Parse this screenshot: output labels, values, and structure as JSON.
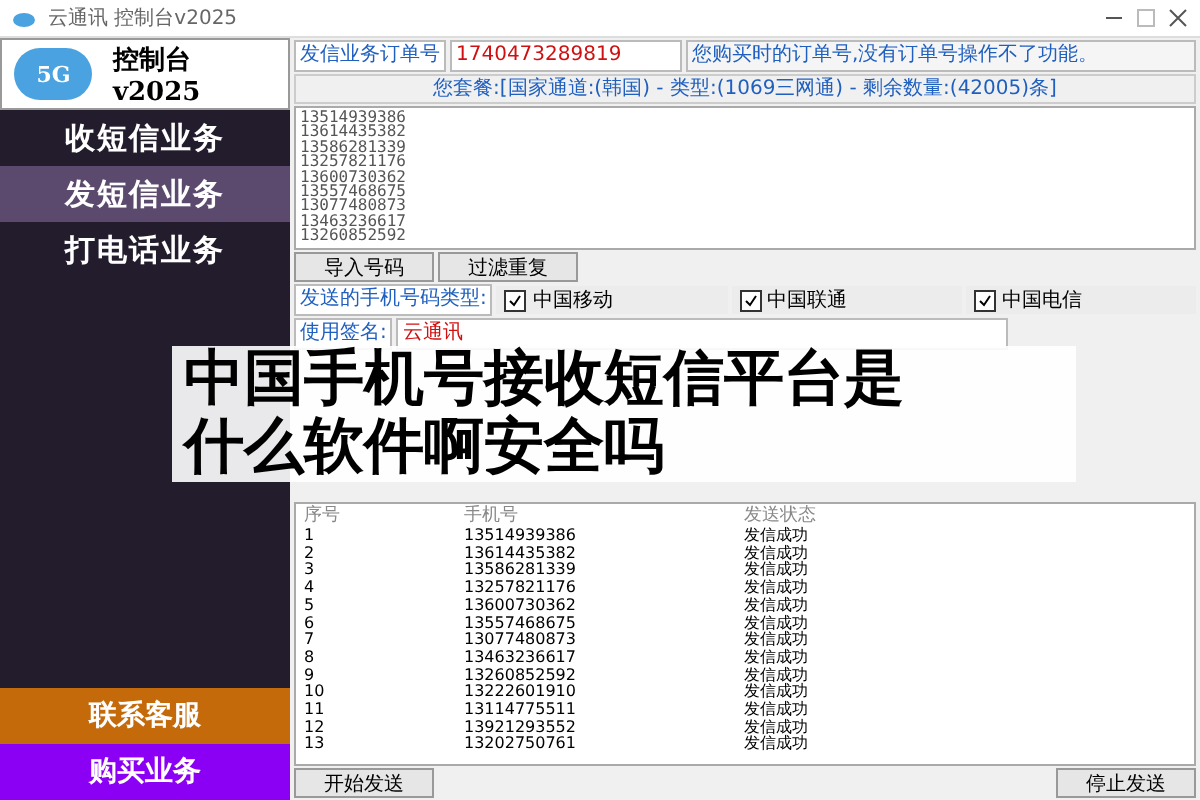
{
  "window": {
    "title": "云通讯 控制台v2025"
  },
  "logo": {
    "badge": "5G",
    "title": "控制台v2025"
  },
  "sidebar": {
    "items": [
      {
        "label": "收短信业务",
        "selected": false
      },
      {
        "label": "发短信业务",
        "selected": true
      },
      {
        "label": "打电话业务",
        "selected": false
      }
    ],
    "bottom_buttons": [
      {
        "label": "联系客服",
        "color": "#c46a0a"
      },
      {
        "label": "购买业务",
        "color": "#8b00f5"
      }
    ]
  },
  "order": {
    "label": "发信业务订单号",
    "value": "1740473289819",
    "hint": "您购买时的订单号,没有订单号操作不了功能。"
  },
  "package_info": "您套餐:[国家通道:(韩国) - 类型:(1069三网通) - 剩余数量:(42005)条]",
  "number_list": [
    "13514939386",
    "13614435382",
    "13586281339",
    "13257821176",
    "13600730362",
    "13557468675",
    "13077480873",
    "13463236617",
    "13260852592"
  ],
  "import_buttons": [
    "导入号码",
    "过滤重复"
  ],
  "carrier_label": "发送的手机号码类型:",
  "carriers": [
    {
      "label": "中国移动",
      "checked": true
    },
    {
      "label": "中国联通",
      "checked": true
    },
    {
      "label": "中国电信",
      "checked": true
    }
  ],
  "signature": {
    "label": "使用签名:",
    "value": "云通讯"
  },
  "table": {
    "columns": [
      "序号",
      "手机号",
      "发送状态"
    ],
    "rows": [
      [
        "1",
        "13514939386",
        "发信成功"
      ],
      [
        "2",
        "13614435382",
        "发信成功"
      ],
      [
        "3",
        "13586281339",
        "发信成功"
      ],
      [
        "4",
        "13257821176",
        "发信成功"
      ],
      [
        "5",
        "13600730362",
        "发信成功"
      ],
      [
        "6",
        "13557468675",
        "发信成功"
      ],
      [
        "7",
        "13077480873",
        "发信成功"
      ],
      [
        "8",
        "13463236617",
        "发信成功"
      ],
      [
        "9",
        "13260852592",
        "发信成功"
      ],
      [
        "10",
        "13222601910",
        "发信成功"
      ],
      [
        "11",
        "13114775511",
        "发信成功"
      ],
      [
        "12",
        "13921293552",
        "发信成功"
      ],
      [
        "13",
        "13202750761",
        "发信成功"
      ]
    ]
  },
  "actions": [
    "开始发送",
    "停止发送"
  ],
  "overlay_title": "中国手机号接收短信平台是什么软件啊安全吗"
}
